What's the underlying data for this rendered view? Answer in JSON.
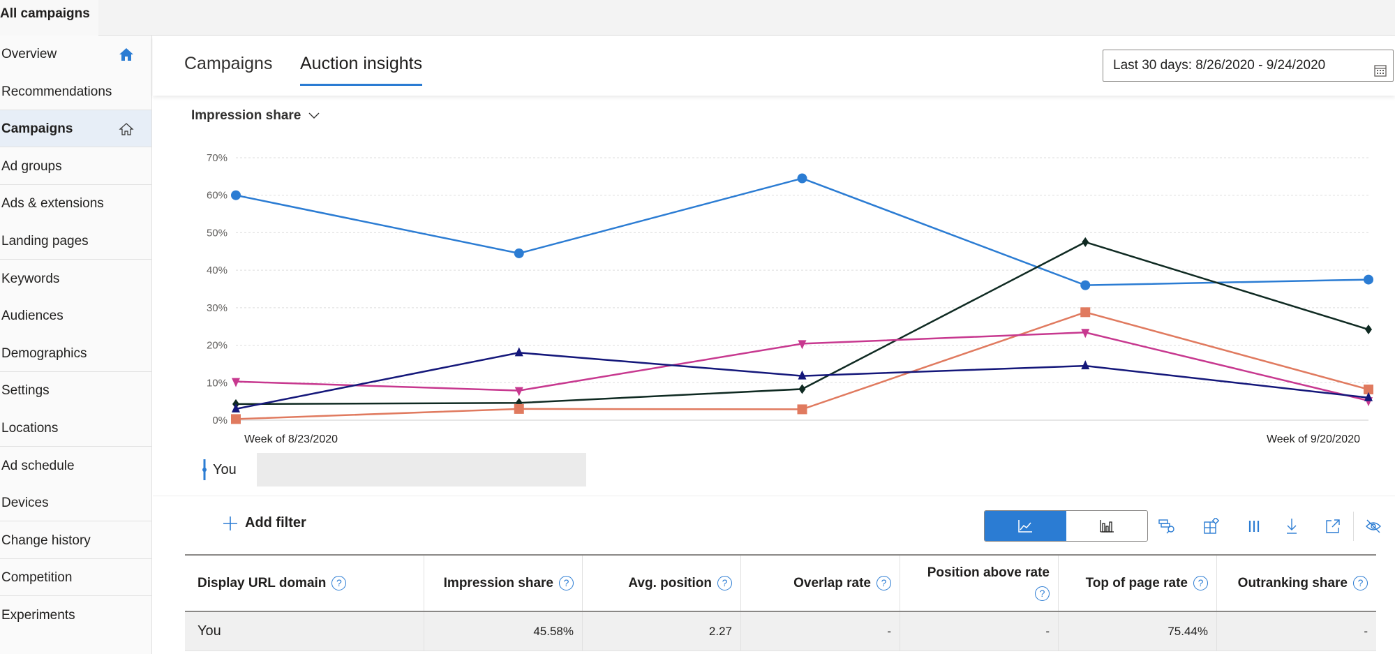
{
  "topbar": {
    "breadcrumb": "All campaigns"
  },
  "sidebar": {
    "items": [
      {
        "label": "Overview",
        "icon": "home-filled-icon"
      },
      {
        "label": "Recommendations"
      },
      {
        "label": "Campaigns",
        "icon": "home-outline-icon",
        "selected": true
      },
      {
        "label": "Ad groups"
      },
      {
        "label": "Ads & extensions"
      },
      {
        "label": "Landing pages"
      },
      {
        "label": "Keywords"
      },
      {
        "label": "Audiences"
      },
      {
        "label": "Demographics"
      },
      {
        "label": "Settings"
      },
      {
        "label": "Locations"
      },
      {
        "label": "Ad schedule"
      },
      {
        "label": "Devices"
      },
      {
        "label": "Change history"
      },
      {
        "label": "Competition"
      },
      {
        "label": "Experiments"
      }
    ]
  },
  "header": {
    "tabs": [
      {
        "label": "Campaigns"
      },
      {
        "label": "Auction insights",
        "active": true
      }
    ],
    "date_range": "Last 30 days: 8/26/2020 - 9/24/2020"
  },
  "chart": {
    "metric_label": "Impression share"
  },
  "chart_data": {
    "type": "line",
    "x": [
      "Week of 8/23/2020",
      "",
      "",
      "",
      "Week of 9/20/2020"
    ],
    "ylim": [
      0,
      70
    ],
    "yticks": [
      "0%",
      "10%",
      "20%",
      "30%",
      "40%",
      "50%",
      "60%",
      "70%"
    ],
    "grid": true,
    "series": [
      {
        "name": "You",
        "color": "#2b7cd3",
        "marker": "circle",
        "values": [
          60,
          44.5,
          64.5,
          36,
          37.5
        ]
      },
      {
        "color": "#0f2a22",
        "marker": "diamond",
        "values": [
          4.3,
          4.6,
          8.3,
          47.5,
          24.2
        ]
      },
      {
        "color": "#e07a5f",
        "marker": "square",
        "values": [
          0.3,
          3,
          2.9,
          28.8,
          8.2
        ]
      },
      {
        "color": "#c7388f",
        "marker": "triangle-down",
        "values": [
          10.3,
          7.9,
          20.4,
          23.4,
          5.2
        ]
      },
      {
        "color": "#14177a",
        "marker": "triangle-up",
        "values": [
          3,
          18,
          11.8,
          14.5,
          6
        ]
      }
    ],
    "legend": "bottom-left"
  },
  "legend": {
    "label": "You"
  },
  "toolbar": {
    "add_filter": "Add filter"
  },
  "table": {
    "headers": [
      "Display URL domain",
      "Impression share",
      "Avg. position",
      "Overlap rate",
      "Position above rate",
      "Top of page rate",
      "Outranking share"
    ],
    "help_icon": "?",
    "rows": [
      [
        "You",
        "45.58%",
        "2.27",
        "-",
        "-",
        "75.44%",
        "-"
      ]
    ]
  }
}
